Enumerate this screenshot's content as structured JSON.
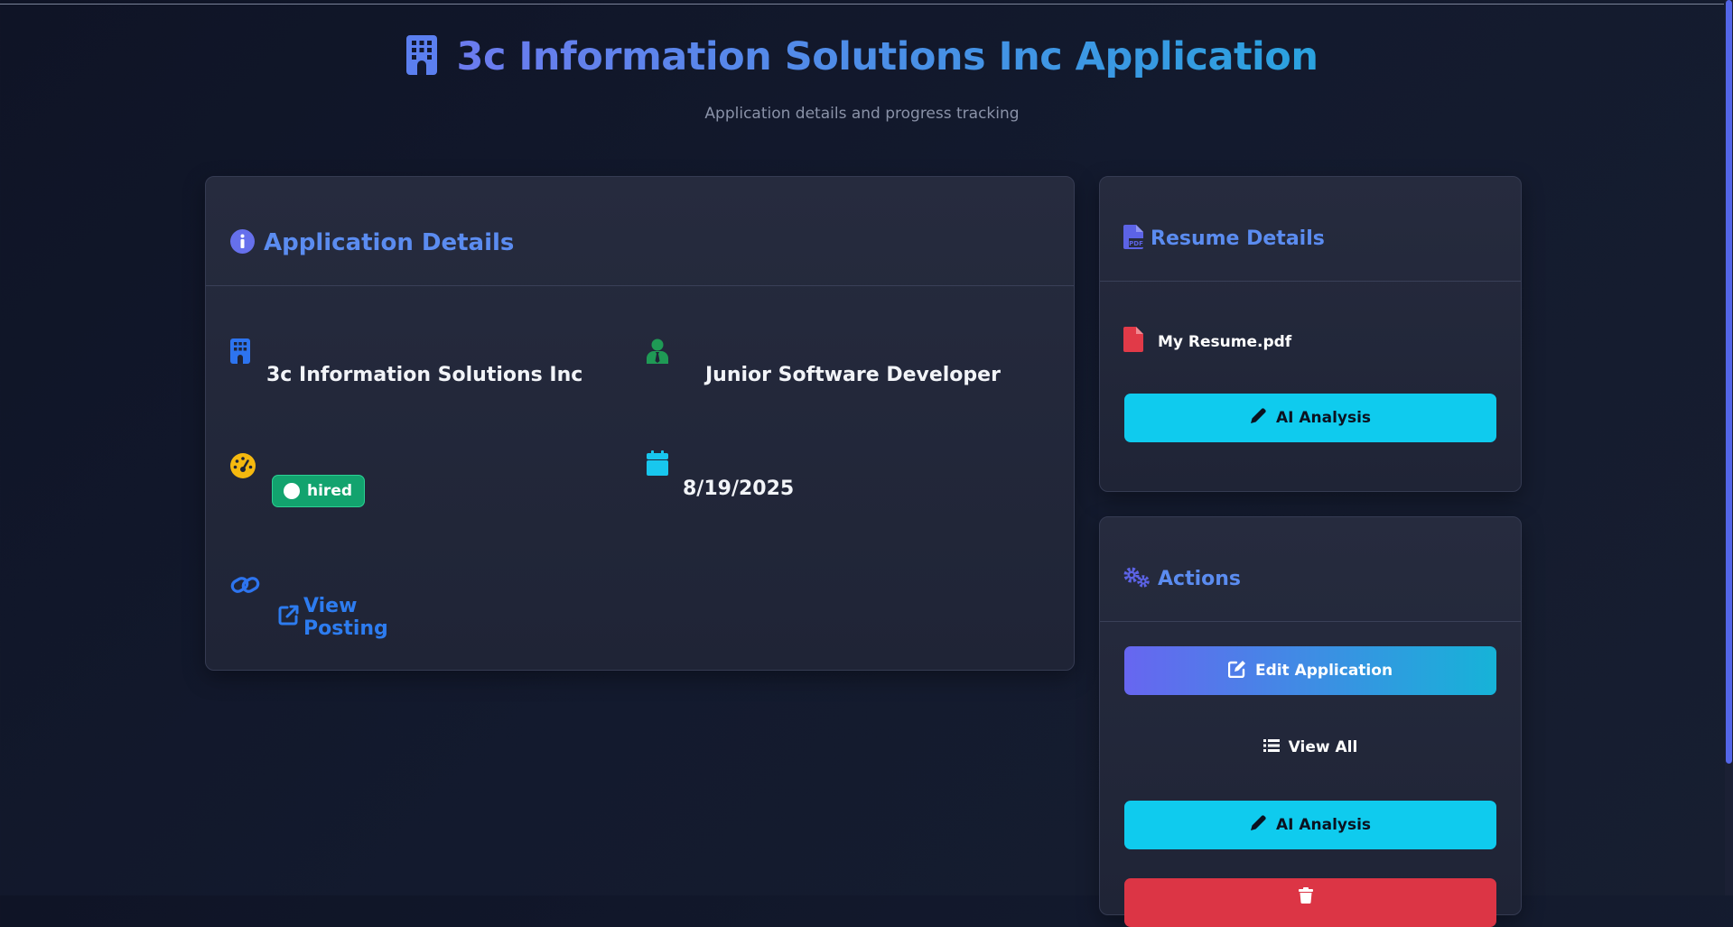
{
  "header": {
    "title": "3c Information Solutions Inc Application",
    "subtitle": "Application details and progress tracking",
    "icon": "building-icon"
  },
  "application_details": {
    "title": "Application Details",
    "icon": "info-circle-icon",
    "company": {
      "icon": "building-icon",
      "value": "3c Information Solutions Inc"
    },
    "position": {
      "icon": "user-tie-icon",
      "value": "Junior Software Developer"
    },
    "status": {
      "icon": "gauge-icon",
      "value": "hired",
      "color": "#12a36e"
    },
    "date": {
      "icon": "calendar-icon",
      "value": "8/19/2025"
    },
    "posting": {
      "icon": "link-icon",
      "link_icon": "external-link-icon",
      "label": "View Posting"
    }
  },
  "resume_details": {
    "title": "Resume Details",
    "icon": "file-pdf-icon",
    "file_name": "My Resume.pdf",
    "file_icon": "file-icon",
    "ai_button": "AI Analysis"
  },
  "actions": {
    "title": "Actions",
    "icon": "cogs-icon",
    "edit_button": "Edit Application",
    "view_all_button": "View All",
    "ai_button": "AI Analysis",
    "delete_button": ""
  },
  "colors": {
    "accent_blue": "#5b8cf0",
    "cyan_button": "#0fcbee",
    "success": "#12a36e",
    "danger": "#dc3545",
    "warning": "#f5b90f"
  }
}
